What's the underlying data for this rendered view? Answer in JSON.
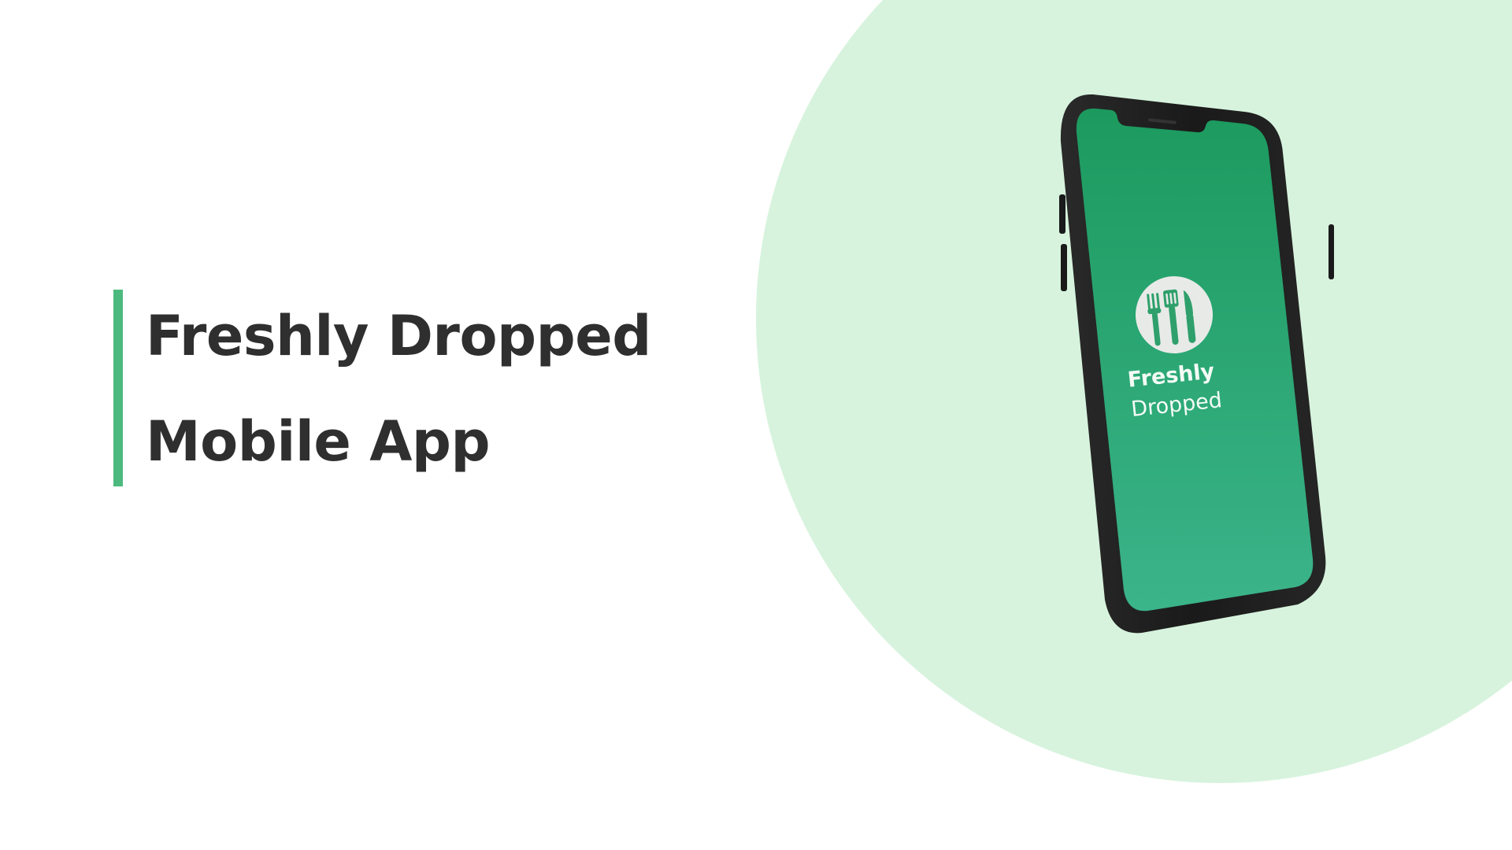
{
  "heading": {
    "line1": "Freshly Dropped",
    "line2": "Mobile App"
  },
  "phone_screen": {
    "brand_line1": "Freshly",
    "brand_line2": "Dropped",
    "logo_icon": "utensils-icon"
  },
  "colors": {
    "accent_bar": "#4cb97e",
    "background_circle": "#d7f3dd",
    "heading_text": "#2f2f2f",
    "screen_gradient_top": "#1c9a5e",
    "screen_gradient_bottom": "#3bb48a",
    "phone_frame": "#1e1e1e"
  }
}
